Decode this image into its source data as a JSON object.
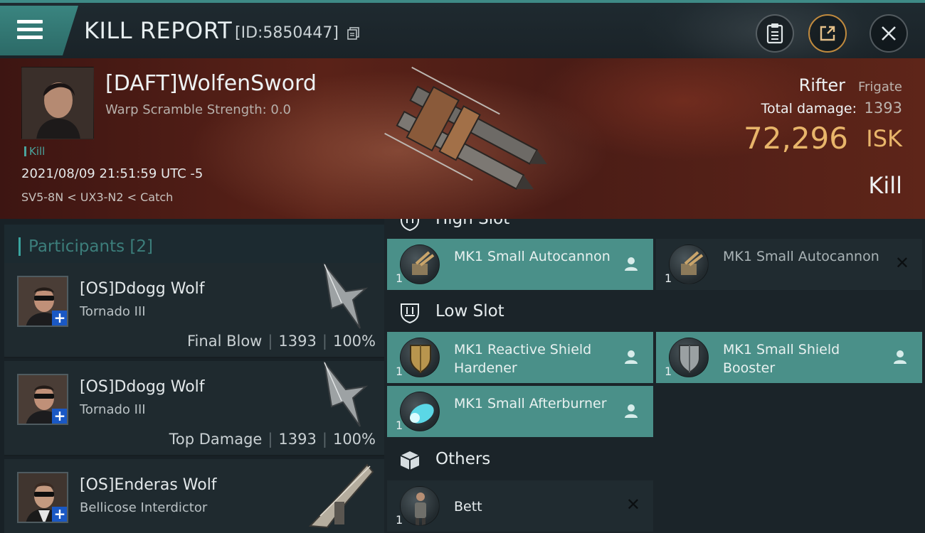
{
  "header": {
    "title": "KILL REPORT",
    "kill_id": "[ID:5850447]",
    "icons": {
      "menu": "hamburger-icon",
      "copy": "copy-icon",
      "clipboard": "clipboard-icon",
      "share": "share-icon",
      "close": "close-icon"
    },
    "accent": "#3e8a86"
  },
  "victim": {
    "name": "[DAFT]WolfenSword",
    "warp_scramble": "Warp Scramble Strength: 0.0",
    "tag": "Kill",
    "time": "2021/08/09 21:51:59 UTC -5",
    "location": "SV5-8N < UX3-N2 < Catch",
    "ship": "Rifter",
    "ship_class": "Frigate",
    "total_damage_label": "Total damage:",
    "total_damage": "1393",
    "isk_value": "72,296",
    "isk_unit": "ISK",
    "result": "Kill",
    "isk_color": "#e8b56a"
  },
  "participants": {
    "heading": "Participants [2]",
    "rows": [
      {
        "name": "[OS]Ddogg Wolf",
        "ship": "Tornado III",
        "role": "Final Blow",
        "damage": "1393",
        "percent": "100%"
      },
      {
        "name": "[OS]Ddogg Wolf",
        "ship": "Tornado III",
        "role": "Top Damage",
        "damage": "1393",
        "percent": "100%"
      },
      {
        "name": "[OS]Enderas Wolf",
        "ship": "Bellicose Interdictor"
      }
    ]
  },
  "fitting": {
    "high_slot": {
      "title": "High Slot",
      "modules": [
        {
          "name": "MK1 Small Autocannon",
          "qty": "1",
          "state": "fitted"
        },
        {
          "name": "MK1 Small Autocannon",
          "qty": "1",
          "state": "destroyed"
        }
      ]
    },
    "low_slot": {
      "title": "Low Slot",
      "modules": [
        {
          "name": "MK1 Reactive Shield Hardener",
          "qty": "1",
          "state": "fitted"
        },
        {
          "name": "MK1 Small Shield Booster",
          "qty": "1",
          "state": "fitted"
        },
        {
          "name": "MK1 Small Afterburner",
          "qty": "1",
          "state": "fitted"
        }
      ]
    },
    "others": {
      "title": "Others",
      "modules": [
        {
          "name": "Bett",
          "qty": "1",
          "state": "destroyed"
        }
      ]
    },
    "fitted_color": "#4a9089"
  }
}
